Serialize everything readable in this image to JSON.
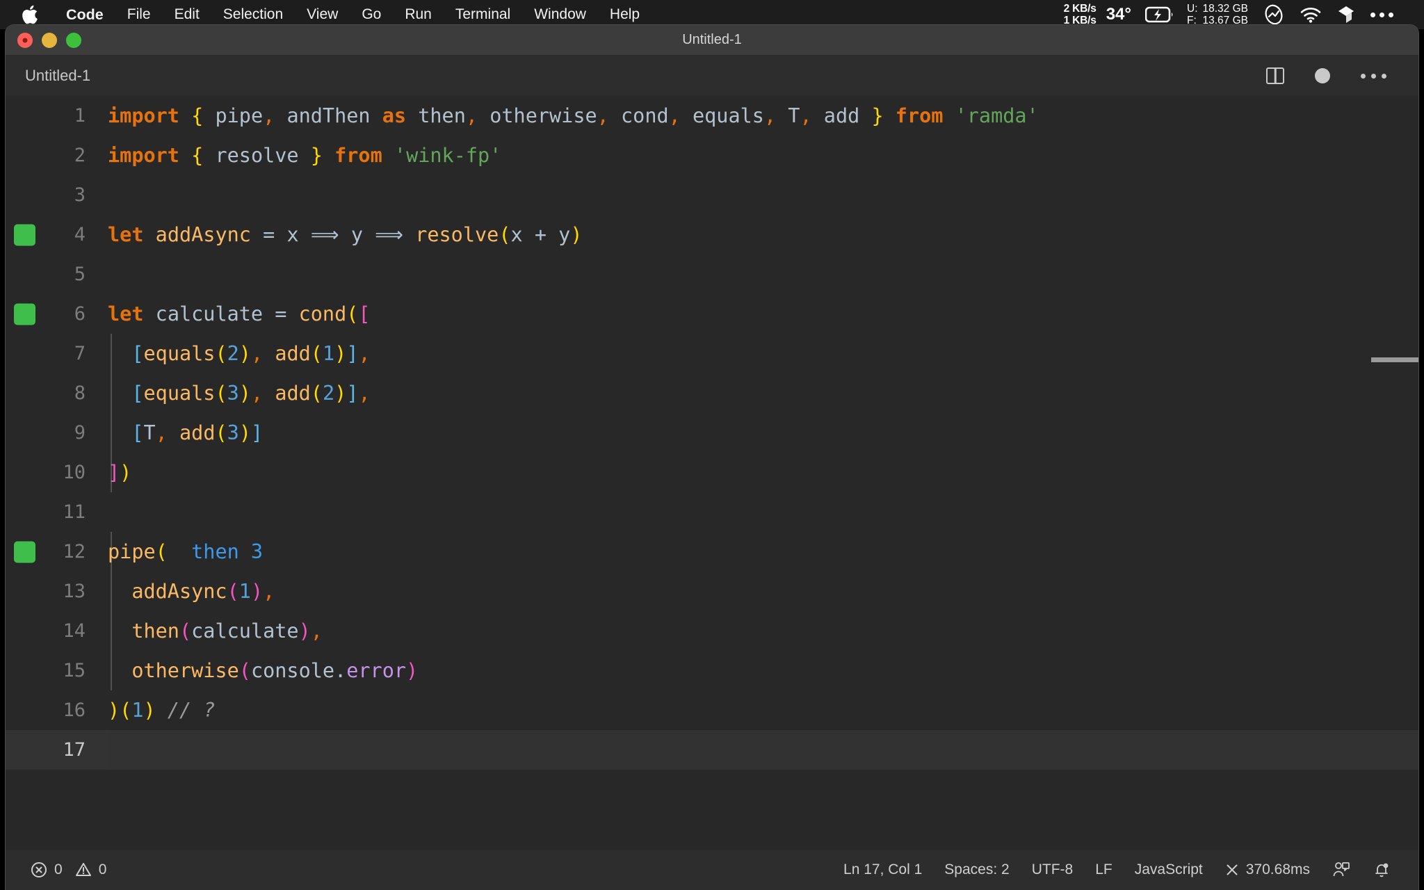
{
  "menubar": {
    "apple_icon": "apple-logo",
    "items": [
      {
        "label": "Code",
        "bold": true
      },
      {
        "label": "File",
        "bold": false
      },
      {
        "label": "Edit",
        "bold": false
      },
      {
        "label": "Selection",
        "bold": false
      },
      {
        "label": "View",
        "bold": false
      },
      {
        "label": "Go",
        "bold": false
      },
      {
        "label": "Run",
        "bold": false
      },
      {
        "label": "Terminal",
        "bold": false
      },
      {
        "label": "Window",
        "bold": false
      },
      {
        "label": "Help",
        "bold": false
      }
    ],
    "status": {
      "net_up": "2 KB/s",
      "net_down": "1 KB/s",
      "temperature": "34°",
      "battery_icon": "battery-charging-icon",
      "mem_used_label": "U:",
      "mem_used_value": "18.32 GB",
      "mem_free_label": "F:",
      "mem_free_value": "13.67 GB",
      "icons": [
        "siri-icon",
        "wifi-icon",
        "dropbox-icon",
        "control-center-icon"
      ]
    }
  },
  "window": {
    "title": "Untitled-1",
    "traffic_lights": [
      "close-button",
      "minimize-button",
      "maximize-button"
    ]
  },
  "tabbar": {
    "tabs": [
      {
        "label": "Untitled-1",
        "active": true
      }
    ],
    "actions": [
      "split-editor-icon",
      "unsaved-dot-icon",
      "more-actions-icon"
    ]
  },
  "editor": {
    "language": "javascript",
    "cursor_line": 17,
    "lines": [
      {
        "n": 1,
        "mark": false,
        "indent": 0
      },
      {
        "n": 2,
        "mark": false,
        "indent": 0
      },
      {
        "n": 3,
        "mark": false,
        "indent": 0
      },
      {
        "n": 4,
        "mark": true,
        "indent": 0
      },
      {
        "n": 5,
        "mark": false,
        "indent": 0
      },
      {
        "n": 6,
        "mark": true,
        "indent": 0
      },
      {
        "n": 7,
        "mark": false,
        "indent": 1
      },
      {
        "n": 8,
        "mark": false,
        "indent": 1
      },
      {
        "n": 9,
        "mark": false,
        "indent": 1
      },
      {
        "n": 10,
        "mark": false,
        "indent": 0
      },
      {
        "n": 11,
        "mark": false,
        "indent": 0
      },
      {
        "n": 12,
        "mark": true,
        "indent": 0
      },
      {
        "n": 13,
        "mark": false,
        "indent": 1
      },
      {
        "n": 14,
        "mark": false,
        "indent": 1
      },
      {
        "n": 15,
        "mark": false,
        "indent": 1
      },
      {
        "n": 16,
        "mark": false,
        "indent": 0
      },
      {
        "n": 17,
        "mark": false,
        "indent": 0
      }
    ],
    "source_text": [
      "import { pipe, andThen as then, otherwise, cond, equals, T, add } from 'ramda'",
      "import { resolve } from 'wink-fp'",
      "",
      "let addAsync = x ⟹ y ⟹ resolve(x + y)",
      "",
      "let calculate = cond([",
      "  [equals(2), add(1)],",
      "  [equals(3), add(2)],",
      "  [T, add(3)]",
      "])",
      "",
      "pipe(",
      "  addAsync(1),",
      "  then(calculate),",
      "  otherwise(console.error)",
      ")(1) // ?",
      ""
    ],
    "inline_annotation": {
      "line": 12,
      "text": "then 3"
    }
  },
  "statusbar": {
    "errors_icon": "error-circle-icon",
    "errors": "0",
    "warnings_icon": "warning-triangle-icon",
    "warnings": "0",
    "cursor_position": "Ln 17, Col 1",
    "indentation": "Spaces: 2",
    "encoding": "UTF-8",
    "eol": "LF",
    "language_mode": "JavaScript",
    "quokka_icon": "close-x-icon",
    "quokka_time": "370.68ms",
    "feedback_icon": "feedback-icon",
    "bell_icon": "bell-dot-icon"
  },
  "colors": {
    "menubar_bg": "#1d1d1d",
    "titlebar_bg": "#3c3c3c",
    "editor_bg": "#282828",
    "tabbar_bg": "#2d2d2d",
    "statusbar_bg": "#2d2d2d",
    "keyword": "#e8720c",
    "string": "#63a65a",
    "function": "#fcb963",
    "number": "#56a3d9",
    "variable": "#b3c2cf",
    "comment": "#9a9a9a",
    "bracket_yellow": "#ffd900",
    "bracket_blue": "#5bb7e8",
    "bracket_pink": "#f455c0",
    "property": "#c792ea",
    "gutter_mark": "#3fbe4c",
    "inline_value": "#3d9ae8"
  }
}
